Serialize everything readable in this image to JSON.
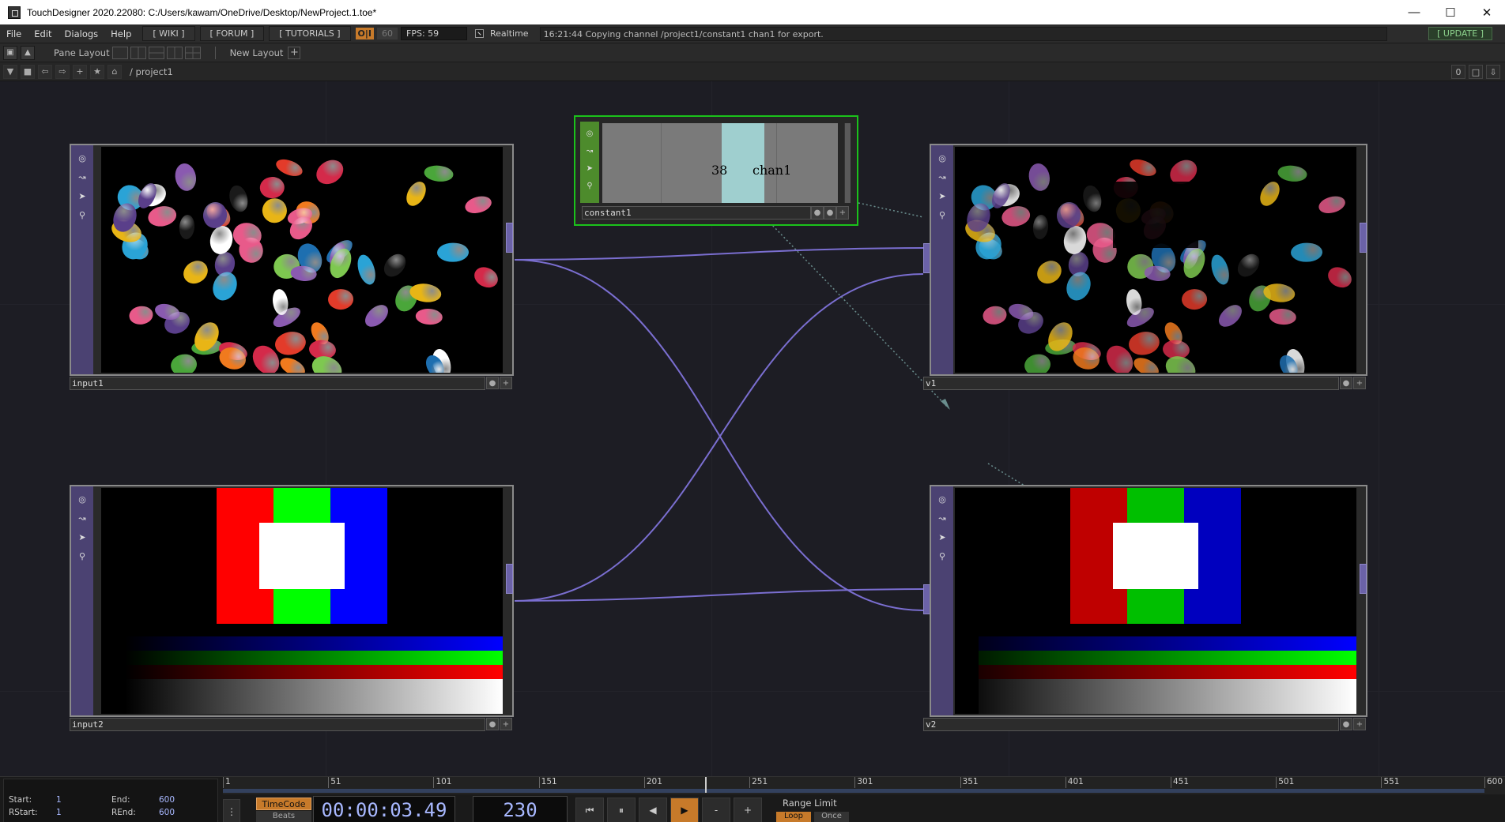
{
  "window": {
    "title": "TouchDesigner 2020.22080: C:/Users/kawam/OneDrive/Desktop/NewProject.1.toe*",
    "minimize_icon": "minimize-icon",
    "maximize_icon": "maximize-icon",
    "close_icon": "close-icon"
  },
  "menu": {
    "items": [
      "File",
      "Edit",
      "Dialogs",
      "Help"
    ],
    "wiki": "[ WIKI ]",
    "forum": "[ FORUM ]",
    "tutorials": "[ TUTORIALS ]",
    "oi": "O|I",
    "fps_cap": "60",
    "fps": "FPS:  59",
    "realtime": "Realtime",
    "status": "16:21:44 Copying channel /project1/constant1 chan1 for export.",
    "update": "[ UPDATE ]"
  },
  "panebar": {
    "pane_layout": "Pane Layout",
    "new_layout": "New Layout",
    "plus": "+"
  },
  "pathbar": {
    "path": "/ project1",
    "counter": "0"
  },
  "nodes": {
    "input1": {
      "label": "input1"
    },
    "input2": {
      "label": "input2"
    },
    "v1": {
      "label": "v1"
    },
    "v2": {
      "label": "v2"
    },
    "constant1": {
      "label": "constant1",
      "value": "38",
      "channel": "chan1"
    }
  },
  "timeline": {
    "start_label": "Start:",
    "start": "1",
    "end_label": "End:",
    "end": "600",
    "rstart_label": "RStart:",
    "rstart": "1",
    "rend_label": "REnd:",
    "rend": "600",
    "ruler": [
      "1",
      "51",
      "101",
      "151",
      "201",
      "251",
      "301",
      "351",
      "401",
      "451",
      "501",
      "551",
      "600"
    ],
    "current_frame": 230,
    "timecode_btn": "TimeCode",
    "beats_btn": "Beats",
    "time": "00:00:03.49",
    "frame": "230",
    "minus": "-",
    "plus": "+",
    "range_limit": "Range Limit",
    "loop": "Loop",
    "once": "Once"
  },
  "colors": {
    "accent_orange": "#c77a2a",
    "node_sidebar": "#4b4272",
    "chop_green": "#1bc21b",
    "wire": "#7a6ed0"
  }
}
